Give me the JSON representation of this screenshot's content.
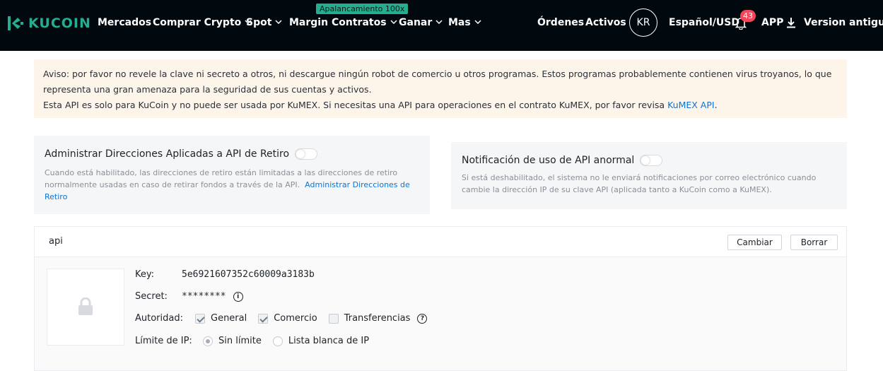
{
  "header": {
    "logo_text": "KUCOIN",
    "nav": [
      {
        "label": "Mercados",
        "dropdown": false
      },
      {
        "label": "Comprar Crypto",
        "dropdown": true
      },
      {
        "label": "Spot",
        "dropdown": true
      },
      {
        "label": "Margin",
        "dropdown": false
      },
      {
        "label": "Contratos",
        "dropdown": true
      },
      {
        "label": "Ganar",
        "dropdown": true
      },
      {
        "label": "Mas",
        "dropdown": true
      }
    ],
    "promo_badge": "Apalancamiento 100x",
    "orders": "Órdenes",
    "assets": "Activos",
    "avatar": "KR",
    "language": "Español/USD",
    "notifications_count": "43",
    "app": "APP",
    "old_version": "Version antigua"
  },
  "notice": {
    "line1": "Aviso: por favor no revele la clave ni secreto a otros, ni descargue ningún robot de comercio u otros programas. Estos programas probablemente contienen virus troyanos, lo que",
    "line2": "representa una gran amenaza para la seguridad de sus cuentas y activos.",
    "line3_prefix": "Esta API es solo para KuCoin y no puede ser usada por KuMEX. Si necesitas una API para operaciones en el contrato KuMEX, por favor revisa ",
    "line3_link": "KuMEX API",
    "line3_suffix": "."
  },
  "withdraw_card": {
    "title": "Administrar Direcciones Aplicadas a API de Retiro",
    "desc": "Cuando está habilitado, las direcciones de retiro están limitadas a las direcciones de retiro normalmente usadas en caso de retirar fondos a través de la API.",
    "link": "Administrar Direcciones de Retiro"
  },
  "abnormal_card": {
    "title": "Notificación de uso de API anormal",
    "desc": "Si está deshabilitado, el sistema no le enviará notificaciones por correo electrónico cuando cambie la dirección IP de su clave API (aplicada tanto a KuCoin como a KuMEX)."
  },
  "api": {
    "name": "api",
    "change_button": "Cambiar",
    "delete_button": "Borrar",
    "key_label": "Key:",
    "key_value": "5e6921607352c60009a3183b",
    "secret_label": "Secret:",
    "secret_value": "********",
    "authority_label": "Autoridad:",
    "permissions": [
      {
        "label": "General",
        "checked": true
      },
      {
        "label": "Comercio",
        "checked": true
      },
      {
        "label": "Transferencias",
        "checked": false
      }
    ],
    "ip_label": "Límite de IP:",
    "ip_options": [
      {
        "label": "Sin límite",
        "selected": true
      },
      {
        "label": "Lista blanca de IP",
        "selected": false
      }
    ]
  },
  "colors": {
    "header_bg": "#01080e",
    "brand": "#24ae8f",
    "notice_bg": "#fef5ea",
    "link": "#0b74d4",
    "badge": "#f0475a"
  }
}
